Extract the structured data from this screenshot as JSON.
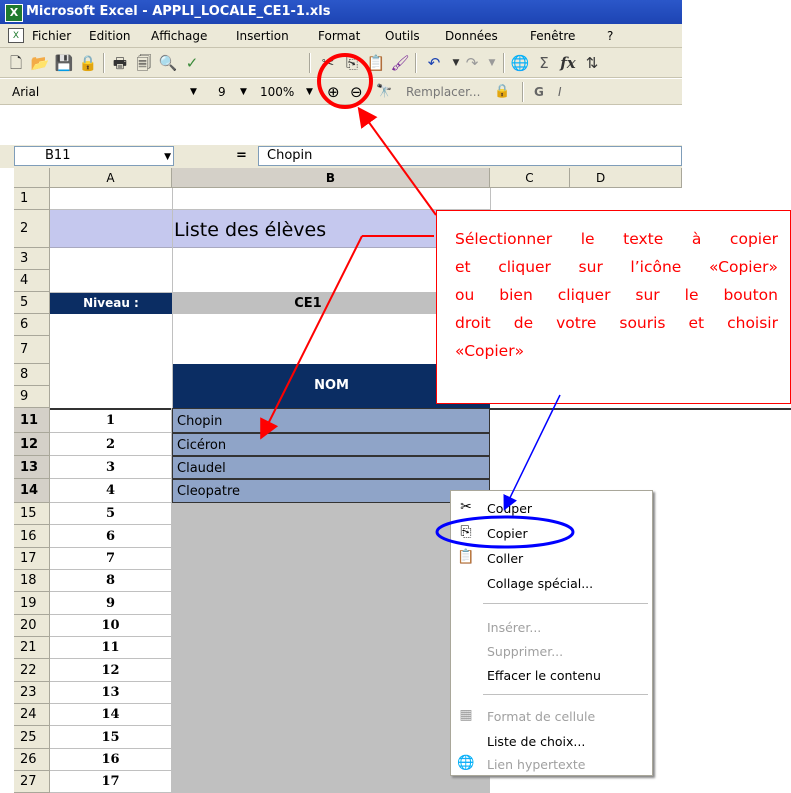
{
  "titlebar": {
    "icon_label": "X",
    "title": "Microsoft Excel - APPLI_LOCALE_CE1-1.xls"
  },
  "menubar": {
    "items": [
      "Fichier",
      "Edition",
      "Affichage",
      "Insertion",
      "Format",
      "Outils",
      "Données",
      "Fenêtre",
      "?"
    ]
  },
  "toolbar": {
    "icons": [
      "new-icon",
      "open-icon",
      "save-icon",
      "permission-icon",
      "print-icon",
      "print-preview-icon",
      "zoom-preview-icon",
      "spelling-icon",
      "cut-icon",
      "copy-icon",
      "paste-icon",
      "format-painter-icon",
      "undo-icon",
      "redo-icon",
      "hyperlink-icon",
      "sum-icon",
      "function-icon",
      "sort-icon"
    ]
  },
  "format_toolbar": {
    "font": "Arial",
    "size": "9",
    "zoom": "100%",
    "replace_label": "Remplacer...",
    "bold": "G",
    "italic": "I"
  },
  "formula_bar": {
    "name_box": "B11",
    "equals": "=",
    "value": "Chopin"
  },
  "columns": [
    "A",
    "B",
    "C",
    "D"
  ],
  "rows": [
    "1",
    "2",
    "3",
    "4",
    "5",
    "6",
    "7",
    "8",
    "9",
    "11",
    "12",
    "13",
    "14",
    "15",
    "16",
    "17",
    "18",
    "19",
    "20",
    "21",
    "22",
    "23",
    "24",
    "25",
    "26",
    "27"
  ],
  "sheet": {
    "title": "Liste des élèves",
    "niveau_label": "Niveau :",
    "niveau_value": "CE1",
    "nom_header": "NOM",
    "numbers": [
      "1",
      "2",
      "3",
      "4",
      "5",
      "6",
      "7",
      "8",
      "9",
      "10",
      "11",
      "12",
      "13",
      "14",
      "15",
      "16",
      "17"
    ],
    "names": [
      "Chopin",
      "Cicéron",
      "Claudel",
      "Cleopatre"
    ]
  },
  "callout": {
    "text": "Sélectionner le texte à copier et cliquer sur l’icône «Copier» ou bien cliquer sur le bouton droit de votre souris et choisir «Copier»",
    "lines": [
      "Sélectionner le texte à copier",
      "et cliquer sur l’icône «Copier»",
      "ou bien cliquer sur le bouton",
      "droit de votre souris et choisir",
      "«Copier»"
    ]
  },
  "context_menu": {
    "items": [
      {
        "label": "Couper",
        "icon": "scissors-icon",
        "enabled": true
      },
      {
        "label": "Copier",
        "icon": "copy-icon",
        "enabled": true
      },
      {
        "label": "Coller",
        "icon": "paste-icon",
        "enabled": true
      },
      {
        "label": "Collage spécial...",
        "icon": "",
        "enabled": true
      },
      {
        "label": "Insérer...",
        "icon": "",
        "enabled": false
      },
      {
        "label": "Supprimer...",
        "icon": "",
        "enabled": false
      },
      {
        "label": "Effacer le contenu",
        "icon": "",
        "enabled": true
      },
      {
        "label": "Format de cellule",
        "icon": "format-cells-icon",
        "enabled": false
      },
      {
        "label": "Liste de choix...",
        "icon": "",
        "enabled": true
      },
      {
        "label": "Lien hypertexte",
        "icon": "hyperlink-icon",
        "enabled": false
      }
    ]
  },
  "colors": {
    "title_blue": "#1d44b3",
    "header_navy": "#0b2d63",
    "lavender": "#c5c8ee",
    "selection_blue": "#8fa4c8",
    "gray_cell": "#c0c0c0",
    "annotation_red": "#ff0000",
    "annotation_blue": "#0000ff"
  }
}
